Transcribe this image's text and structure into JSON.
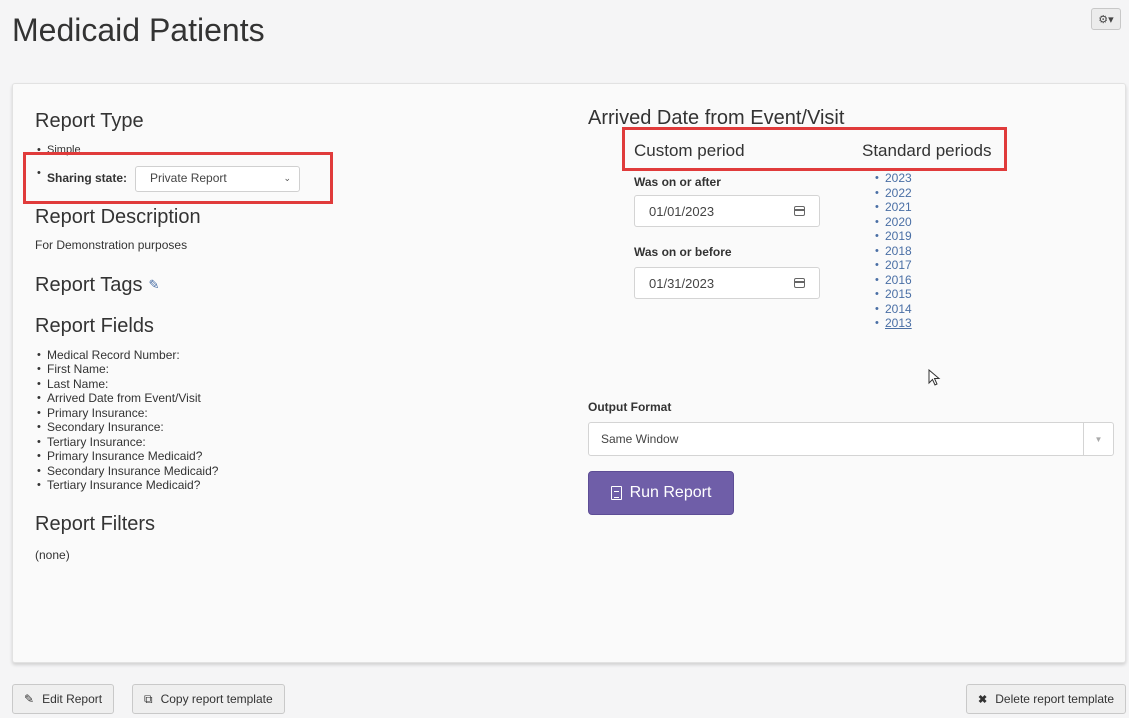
{
  "page": {
    "title": "Medicaid Patients"
  },
  "header": {
    "settings_label": "⚙▾"
  },
  "left": {
    "report_type_heading": "Report Type",
    "report_type_value": "Simple",
    "sharing_label": "Sharing state:",
    "sharing_value": "Private Report",
    "description_heading": "Report Description",
    "description_text": "For Demonstration purposes",
    "tags_heading": "Report Tags",
    "fields_heading": "Report Fields",
    "fields": [
      "Medical Record Number:",
      "First Name:",
      "Last Name:",
      "Arrived Date from Event/Visit",
      "Primary Insurance:",
      "Secondary Insurance:",
      "Tertiary Insurance:",
      "Primary Insurance Medicaid?",
      "Secondary Insurance Medicaid?",
      "Tertiary Insurance Medicaid?"
    ],
    "filters_heading": "Report Filters",
    "filters_text": "(none)"
  },
  "right": {
    "date_heading": "Arrived Date from Event/Visit",
    "custom_period": "Custom period",
    "standard_periods": "Standard periods",
    "on_or_after_label": "Was on or after",
    "on_or_after_value": "01/01/2023",
    "on_or_before_label": "Was on or before",
    "on_or_before_value": "01/31/2023",
    "years": [
      "2023",
      "2022",
      "2021",
      "2020",
      "2019",
      "2018",
      "2017",
      "2016",
      "2015",
      "2014",
      "2013"
    ],
    "output_format_label": "Output Format",
    "output_format_value": "Same Window",
    "run_label": "Run Report"
  },
  "footer": {
    "edit_label": "Edit Report",
    "copy_label": "Copy report template",
    "delete_label": "Delete report template"
  },
  "colors": {
    "highlight": "#e03b3b",
    "run_button": "#6f5ea8",
    "link": "#4a6fa5"
  }
}
